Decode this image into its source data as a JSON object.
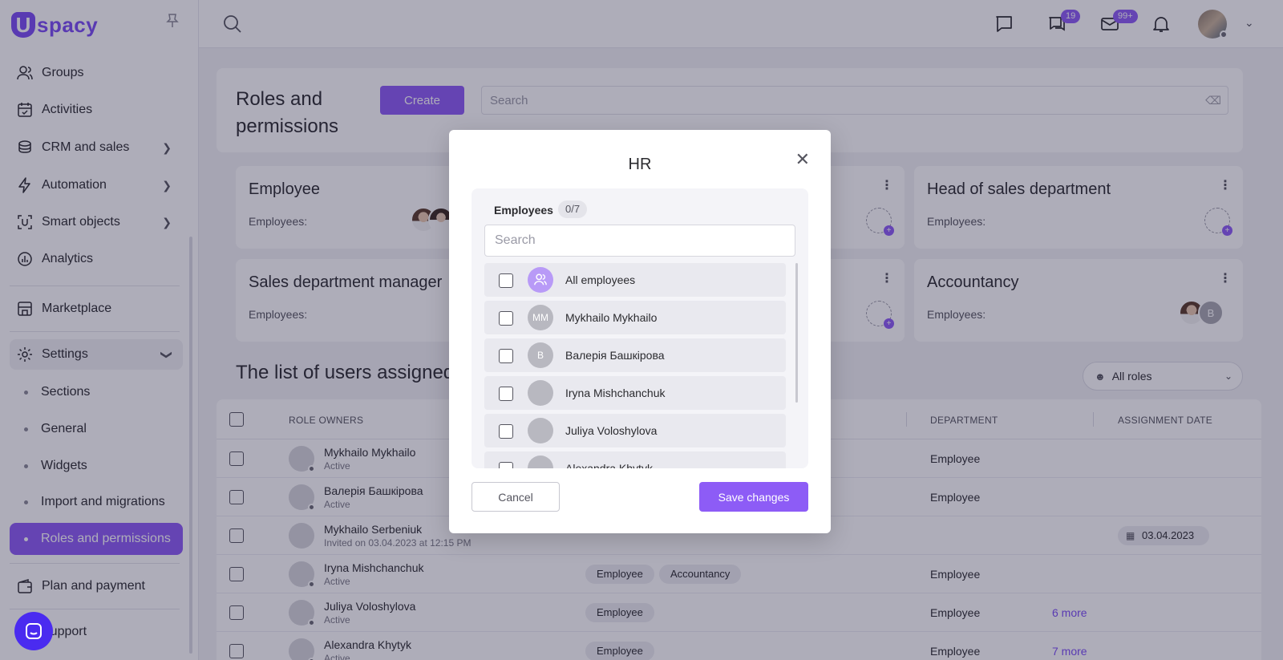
{
  "brand": {
    "logo_letter": "U",
    "logo_text": "spacy"
  },
  "sidebar": {
    "items": [
      {
        "label": "Groups",
        "icon": "users-icon"
      },
      {
        "label": "Activities",
        "icon": "calendar-check-icon"
      },
      {
        "label": "CRM and sales",
        "icon": "coins-icon"
      },
      {
        "label": "Automation",
        "icon": "lightning-icon"
      },
      {
        "label": "Smart objects",
        "icon": "smart-object-icon"
      },
      {
        "label": "Analytics",
        "icon": "chart-pie-icon"
      },
      {
        "label": "Marketplace",
        "icon": "store-icon"
      },
      {
        "label": "Settings",
        "icon": "gear-icon"
      }
    ],
    "settings_sub": [
      "Sections",
      "General",
      "Widgets",
      "Import and migrations",
      "Roles and permissions"
    ],
    "bottom": [
      {
        "label": "Plan and payment",
        "icon": "wallet-icon"
      },
      {
        "label": "Support",
        "icon": "help-icon"
      }
    ]
  },
  "topbar": {
    "chat_badge": "19",
    "mail_badge": "99+"
  },
  "page": {
    "title": "Roles and permissions",
    "create_label": "Create",
    "search_placeholder": "Search",
    "list_title": "The list of users assigned to roles",
    "role_filter": "All roles"
  },
  "cards": [
    {
      "title": "Employee",
      "sub": "Employees:"
    },
    {
      "title": "",
      "sub": ""
    },
    {
      "title": "Head of sales department",
      "sub": "Employees:"
    },
    {
      "title": "Sales department manager",
      "sub": "Employees:"
    },
    {
      "title": "",
      "sub": ""
    },
    {
      "title": "Accountancy",
      "sub": "Employees:",
      "avatar_initial": "В"
    }
  ],
  "table": {
    "headers": {
      "owners": "ROLE OWNERS",
      "department": "DEPARTMENT",
      "date": "ASSIGNMENT DATE"
    },
    "rows": [
      {
        "name": "Mykhailo Mykhailo",
        "status": "Active",
        "dept": "Employee",
        "tags": [],
        "more": "",
        "date": ""
      },
      {
        "name": "Валерія Башкірова",
        "status": "Active",
        "dept": "Employee",
        "tags": [],
        "more": "",
        "date": ""
      },
      {
        "name": "Mykhailo Serbeniuk",
        "status": "Invited on 03.04.2023 at 12:15 PM",
        "dept": "",
        "tags": [],
        "more": "",
        "date": "03.04.2023"
      },
      {
        "name": "Iryna Mishchanchuk",
        "status": "Active",
        "dept": "Employee",
        "tags": [
          "Employee",
          "Accountancy"
        ],
        "more": "",
        "date": ""
      },
      {
        "name": "Juliya Voloshylova",
        "status": "Active",
        "dept": "Employee",
        "tags": [
          "Employee"
        ],
        "more": "6 more",
        "date": ""
      },
      {
        "name": "Alexandra Khytyk",
        "status": "Active",
        "dept": "Employee",
        "tags": [
          "Employee"
        ],
        "more": "7 more",
        "date": ""
      }
    ]
  },
  "modal": {
    "title": "HR",
    "employees_label": "Employees",
    "employees_count": "0/7",
    "search_placeholder": "Search",
    "employees": [
      {
        "name": "All employees",
        "initials": ""
      },
      {
        "name": "Mykhailo Mykhailo",
        "initials": "MM"
      },
      {
        "name": "Валерія Башкірова",
        "initials": "В"
      },
      {
        "name": "Iryna Mishchanchuk",
        "initials": ""
      },
      {
        "name": "Juliya Voloshylova",
        "initials": ""
      },
      {
        "name": "Alexandra Khytyk",
        "initials": ""
      }
    ],
    "cancel_label": "Cancel",
    "save_label": "Save changes"
  },
  "colors": {
    "accent": "#8d5cf6",
    "brand": "#7b4cf5",
    "fab": "#4a2bf0"
  }
}
